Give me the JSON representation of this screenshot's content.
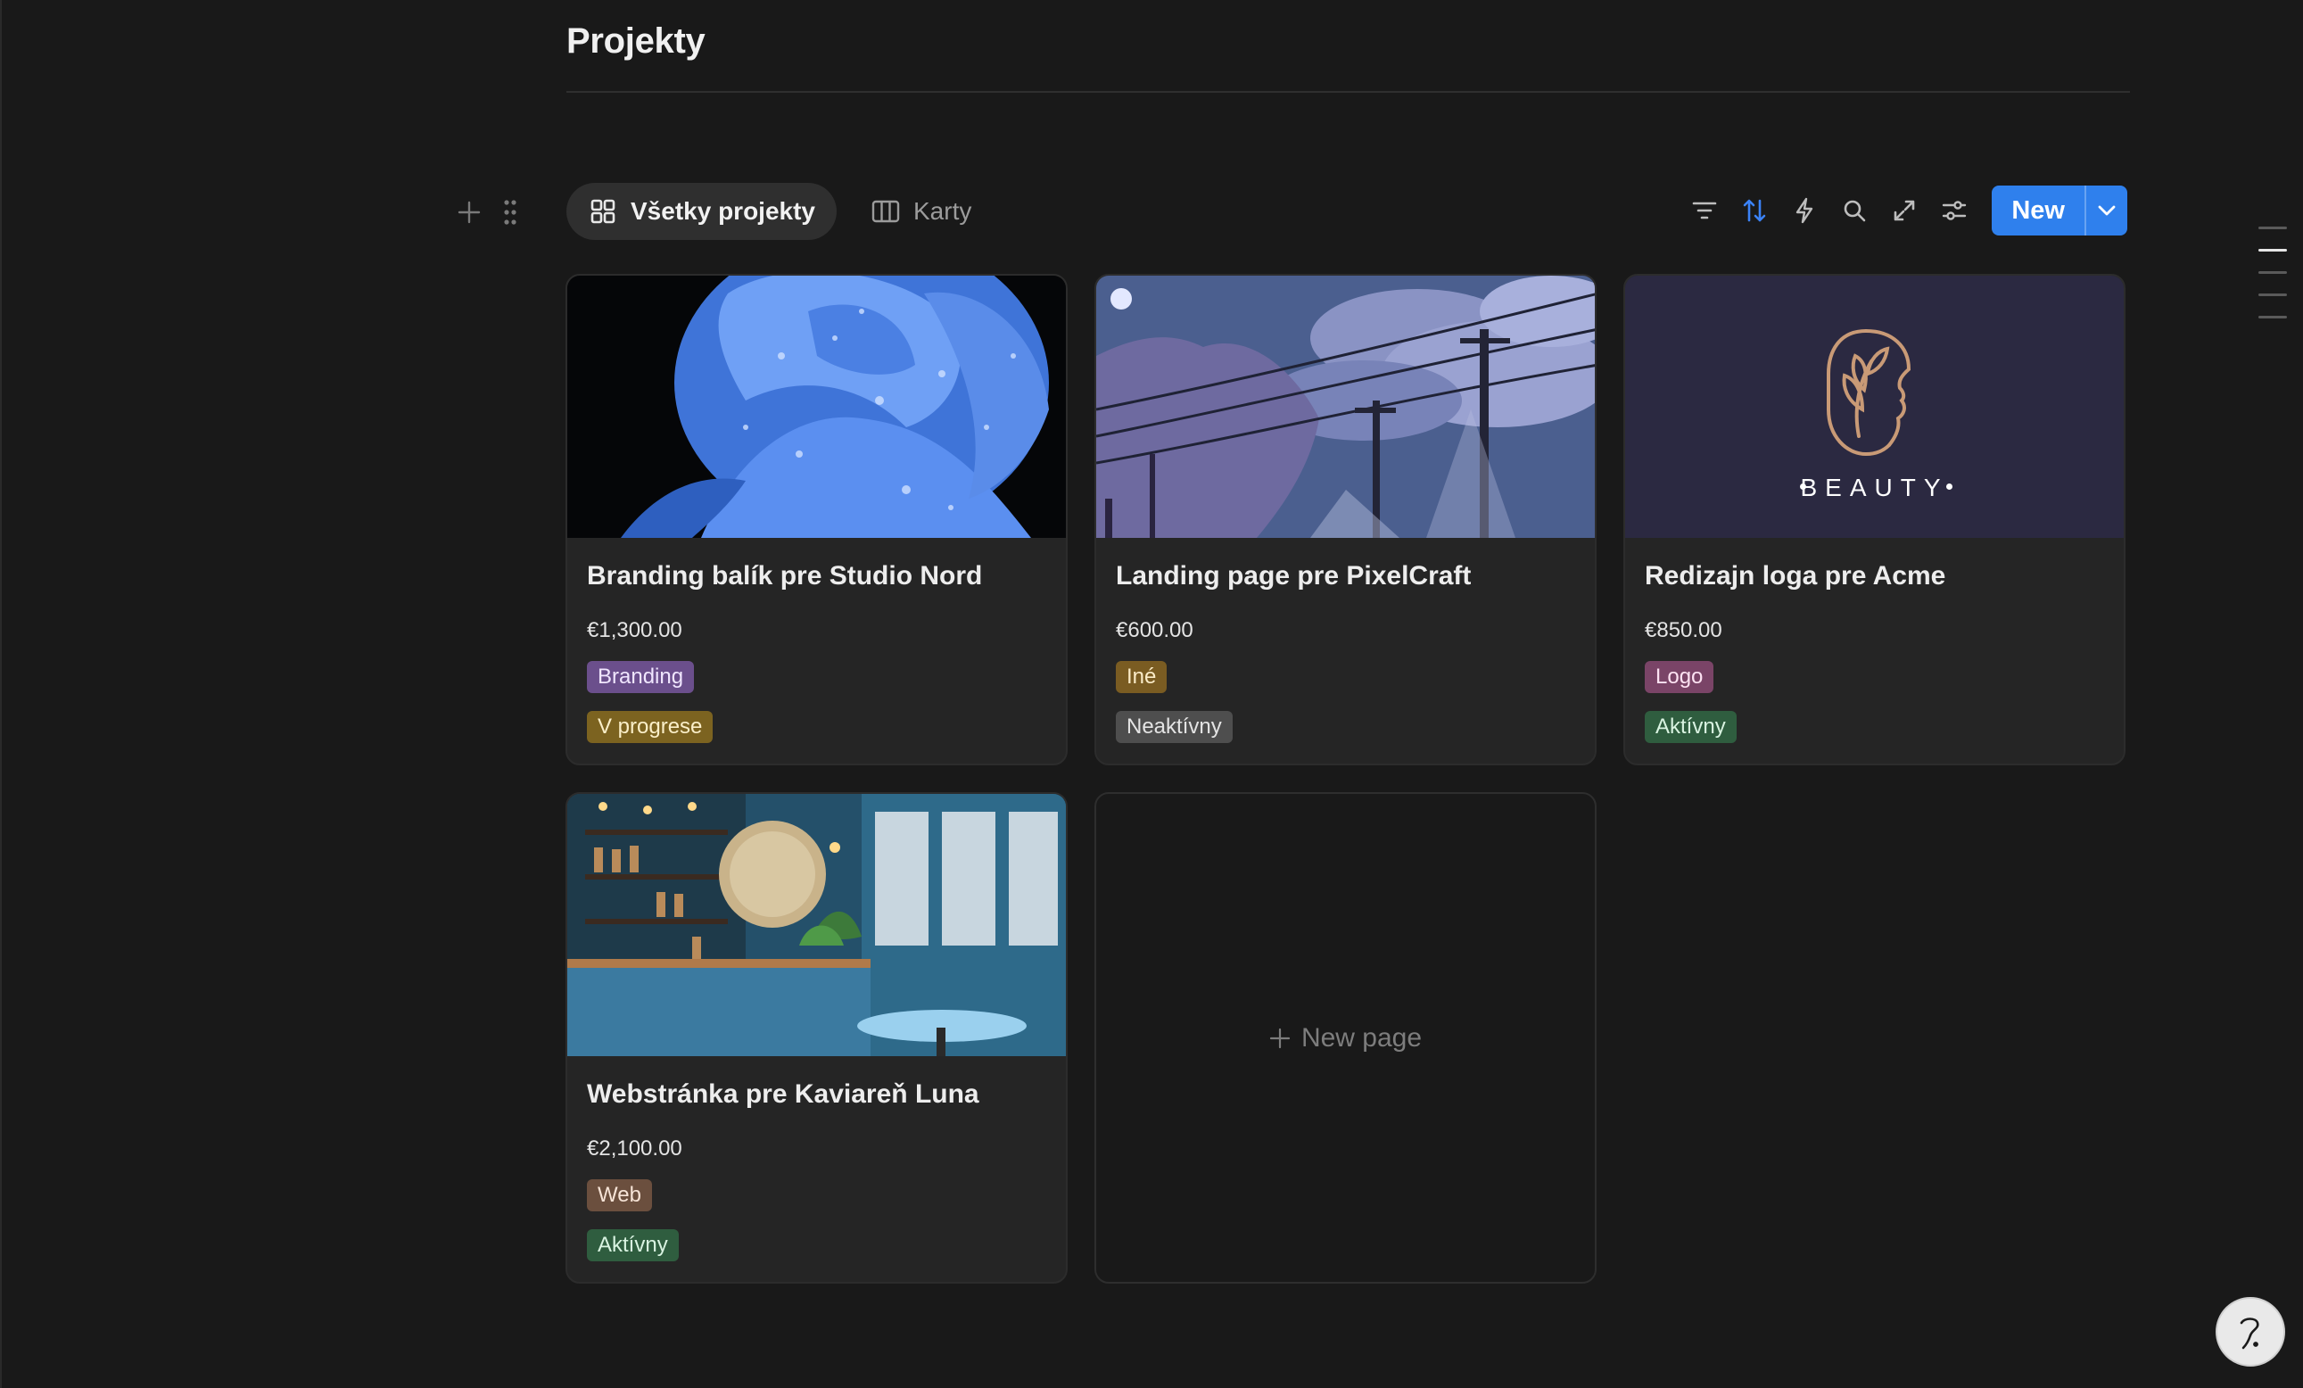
{
  "page": {
    "title": "Projekty"
  },
  "tabs": [
    {
      "label": "Všetky projekty",
      "icon": "gallery-grid-icon",
      "active": true
    },
    {
      "label": "Karty",
      "icon": "board-columns-icon",
      "active": false
    }
  ],
  "toolbar": {
    "new_label": "New",
    "icons": [
      "filter-icon",
      "sort-icon",
      "lightning-icon",
      "search-icon",
      "expand-icon",
      "settings-sliders-icon",
      "chevron-down-icon"
    ]
  },
  "cards": [
    {
      "title": "Branding balík pre Studio Nord",
      "price": "€1,300.00",
      "category": "Branding",
      "status": "V progrese"
    },
    {
      "title": "Landing page pre PixelCraft",
      "price": "€600.00",
      "category": "Iné",
      "status": "Neaktívny"
    },
    {
      "title": "Redizajn loga pre Acme",
      "price": "€850.00",
      "category": "Logo",
      "status": "Aktívny",
      "cover_text": "BEAUTY"
    },
    {
      "title": "Webstránka pre Kaviareň Luna",
      "price": "€2,100.00",
      "category": "Web",
      "status": "Aktívny"
    }
  ],
  "new_page_label": "New page",
  "colors": {
    "accent": "#2f80ed",
    "tag_branding": "#6b4f8c",
    "tag_ine": "#7a5c22",
    "tag_logo": "#7a4467",
    "tag_web": "#6b4f3e",
    "status_progress": "#7c6320",
    "status_inactive": "#4e4e4e",
    "status_active": "#2f5d3f"
  }
}
